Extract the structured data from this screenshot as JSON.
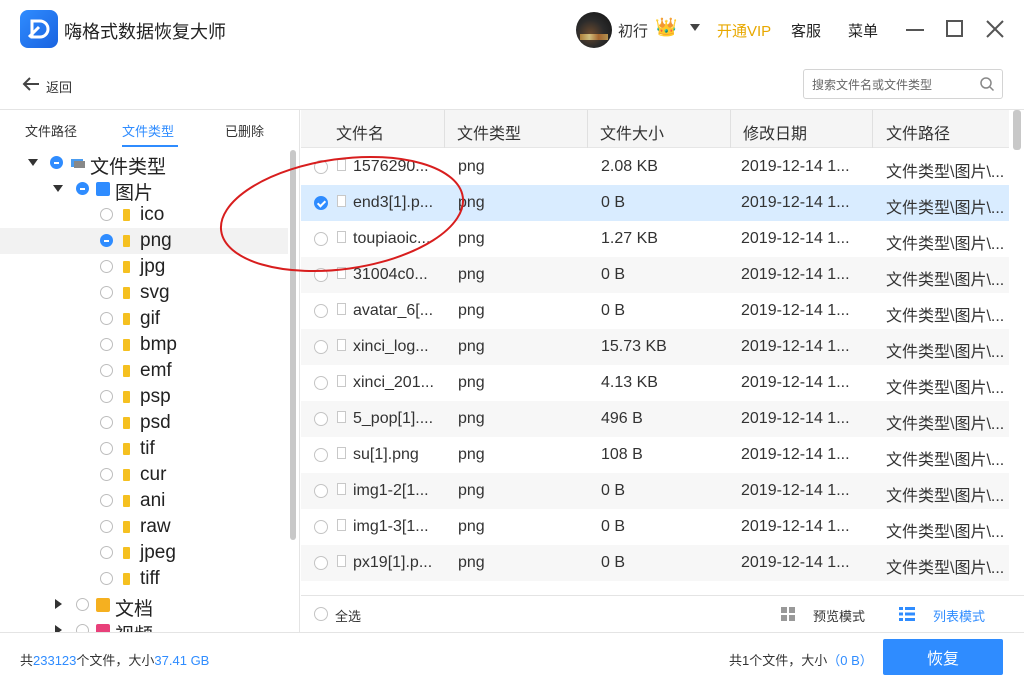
{
  "titlebar": {
    "app_title": "嗨格式数据恢复大师",
    "username": "初行",
    "vip_label": "开通VIP",
    "service_label": "客服",
    "menu_label": "菜单"
  },
  "nav": {
    "back_label": "返回",
    "search_placeholder": "搜索文件名或文件类型"
  },
  "left": {
    "tabs": [
      {
        "label": "文件路径",
        "active": false
      },
      {
        "label": "文件类型",
        "active": true
      },
      {
        "label": "已删除",
        "active": false
      }
    ],
    "tree_root": "文件类型",
    "tree_images": "图片",
    "subtypes": [
      "ico",
      "png",
      "jpg",
      "svg",
      "gif",
      "bmp",
      "emf",
      "psp",
      "psd",
      "tif",
      "cur",
      "ani",
      "raw",
      "jpeg",
      "tiff"
    ],
    "selected_subtype": "png",
    "tree_docs": "文档",
    "tree_video": "视频"
  },
  "table": {
    "columns": [
      "文件名",
      "文件类型",
      "文件大小",
      "修改日期",
      "文件路径"
    ],
    "rows": [
      {
        "name": "1576290...",
        "type": "png",
        "size": "2.08 KB",
        "date": "2019-12-14 1...",
        "path": "文件类型\\图片\\..."
      },
      {
        "name": "end3[1].p...",
        "type": "png",
        "size": "0 B",
        "date": "2019-12-14 1...",
        "path": "文件类型\\图片\\..."
      },
      {
        "name": "toupiaoic...",
        "type": "png",
        "size": "1.27 KB",
        "date": "2019-12-14 1...",
        "path": "文件类型\\图片\\..."
      },
      {
        "name": "31004c0...",
        "type": "png",
        "size": "0 B",
        "date": "2019-12-14 1...",
        "path": "文件类型\\图片\\..."
      },
      {
        "name": "avatar_6[...",
        "type": "png",
        "size": "0 B",
        "date": "2019-12-14 1...",
        "path": "文件类型\\图片\\..."
      },
      {
        "name": "xinci_log...",
        "type": "png",
        "size": "15.73 KB",
        "date": "2019-12-14 1...",
        "path": "文件类型\\图片\\..."
      },
      {
        "name": "xinci_201...",
        "type": "png",
        "size": "4.13 KB",
        "date": "2019-12-14 1...",
        "path": "文件类型\\图片\\..."
      },
      {
        "name": "5_pop[1]....",
        "type": "png",
        "size": "496 B",
        "date": "2019-12-14 1...",
        "path": "文件类型\\图片\\..."
      },
      {
        "name": "su[1].png",
        "type": "png",
        "size": "108 B",
        "date": "2019-12-14 1...",
        "path": "文件类型\\图片\\..."
      },
      {
        "name": "img1-2[1...",
        "type": "png",
        "size": "0 B",
        "date": "2019-12-14 1...",
        "path": "文件类型\\图片\\..."
      },
      {
        "name": "img1-3[1...",
        "type": "png",
        "size": "0 B",
        "date": "2019-12-14 1...",
        "path": "文件类型\\图片\\..."
      },
      {
        "name": "px19[1].p...",
        "type": "png",
        "size": "0 B",
        "date": "2019-12-14 1...",
        "path": "文件类型\\图片\\..."
      }
    ],
    "selected_row": 1,
    "select_all_label": "全选",
    "preview_label": "预览模式",
    "list_label": "列表模式"
  },
  "status": {
    "left_prefix": "共",
    "total_files": "233123",
    "left_mid": "个文件，大小",
    "total_size": "37.41 GB",
    "right_prefix": "共1个文件，大小",
    "selected_size": "（0 B）",
    "recover_label": "恢复"
  },
  "colors": {
    "accent": "#2f8cff",
    "vip": "#e8a800",
    "annotation": "#d81e1e"
  }
}
